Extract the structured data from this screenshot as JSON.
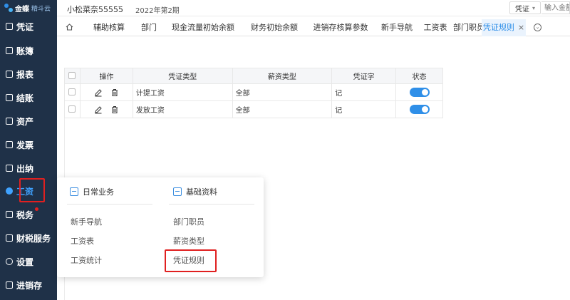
{
  "app": {
    "logo_text": "金蝶",
    "logo_sub": "精斗云",
    "company": "小松菜奈55555",
    "period": "2022年第2期"
  },
  "search": {
    "scope": "凭证",
    "placeholder": "输入金额"
  },
  "sidebar": {
    "items": [
      {
        "label": "凭证"
      },
      {
        "label": "账簿"
      },
      {
        "label": "报表"
      },
      {
        "label": "结账"
      },
      {
        "label": "资产"
      },
      {
        "label": "发票"
      },
      {
        "label": "出纳"
      },
      {
        "label": "工资",
        "active": true
      },
      {
        "label": "税务"
      },
      {
        "label": "财税服务"
      },
      {
        "label": "设置"
      },
      {
        "label": "进销存"
      }
    ]
  },
  "tabs": [
    {
      "label": "辅助核算"
    },
    {
      "label": "部门"
    },
    {
      "label": "现金流量初始余额"
    },
    {
      "label": "财务初始余额"
    },
    {
      "label": "进销存核算参数"
    },
    {
      "label": "新手导航"
    },
    {
      "label": "工资表"
    },
    {
      "label": "部门职员"
    },
    {
      "label": "凭证规则",
      "active": true,
      "close": "×"
    }
  ],
  "table": {
    "headers": [
      "操作",
      "凭证类型",
      "薪资类型",
      "凭证字",
      "状态"
    ],
    "rows": [
      {
        "voucher_type": "计提工资",
        "salary_type": "全部",
        "voucher_word": "记",
        "enabled": true
      },
      {
        "voucher_type": "发放工资",
        "salary_type": "全部",
        "voucher_word": "记",
        "enabled": true
      }
    ]
  },
  "popup": {
    "left": {
      "title": "日常业务",
      "items": [
        "新手导航",
        "工资表",
        "工资统计"
      ]
    },
    "right": {
      "title": "基础资料",
      "items": [
        "部门职员",
        "薪资类型",
        "凭证规则"
      ]
    }
  },
  "colors": {
    "sidebar_bg": "#1f3148",
    "accent": "#2f8fe8",
    "highlight": "#e02020"
  }
}
